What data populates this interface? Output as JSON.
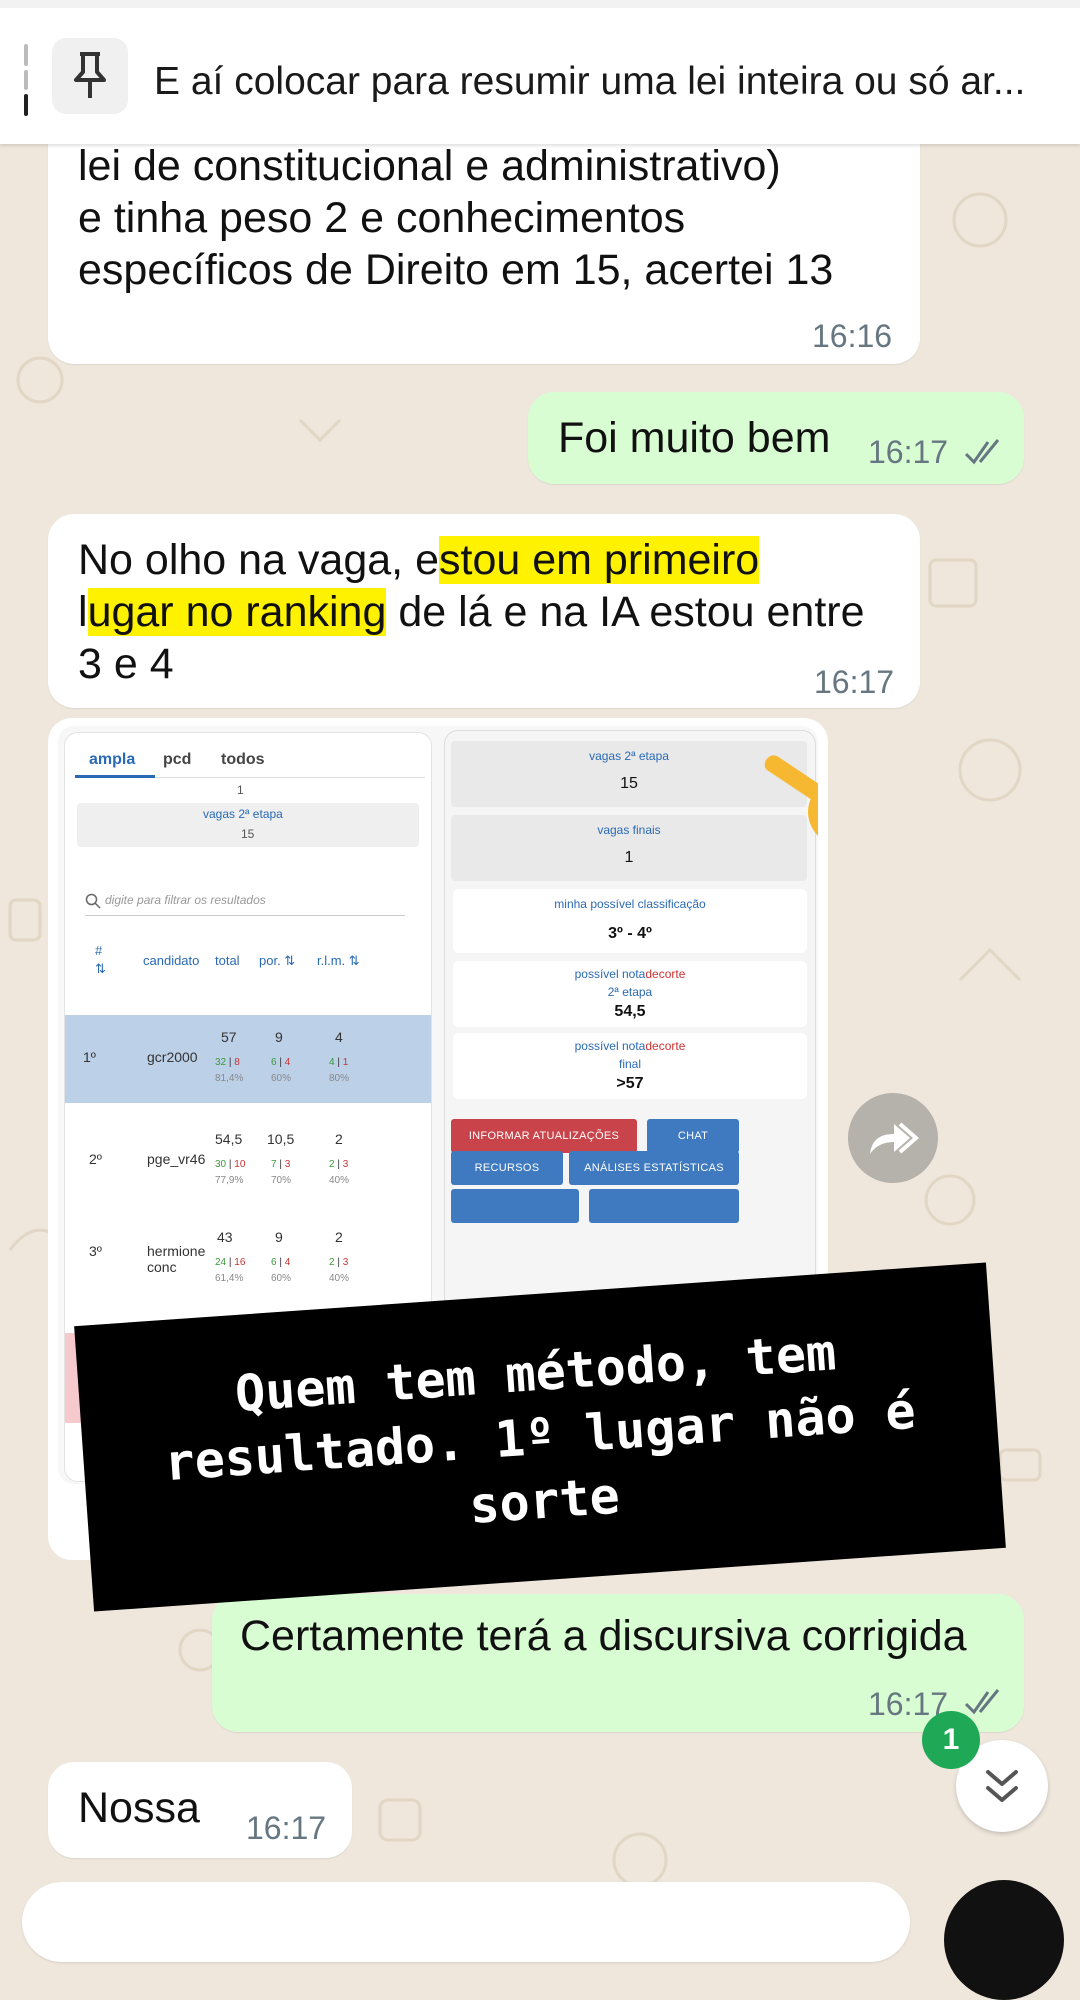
{
  "pinned": {
    "text": "E aí colocar para resumir uma lei inteira ou só ar..."
  },
  "messages": [
    {
      "lines": [
        "lei de constitucional e administrativo)",
        "e tinha peso 2 e conhecimentos",
        "específicos de Direito em 15, acertei 13"
      ],
      "time": "16:16"
    },
    {
      "text": "Foi muito bem",
      "time": "16:17"
    },
    {
      "line1_a": "No olho na vaga, e",
      "line1_hl": "stou em primeiro",
      "line2_a": "l",
      "line2_hl": "ugar no ranking",
      "line2_b": " de lá e na IA estou entre",
      "line3": "3 e 4",
      "time": "16:17"
    },
    {
      "text": "Certamente terá a discursiva corrigida",
      "time": "16:17"
    },
    {
      "text": "Nossa",
      "time": "16:17"
    }
  ],
  "shot": {
    "tabs": [
      "ampla",
      "pcd",
      "todos"
    ],
    "top_value": "1",
    "vagas_label": "vagas 2ª etapa",
    "vagas_value": "15",
    "filter_placeholder": "digite para filtrar os resultados",
    "headers": [
      "#",
      "candidato",
      "total",
      "por. ⇅",
      "r.l.m. ⇅"
    ],
    "rows": [
      {
        "rank": "1º",
        "name": "gcr2000",
        "total": "57",
        "total_g": "32",
        "total_r": "8",
        "total_p": "81,4%",
        "por": "9",
        "por_g": "6",
        "por_r": "4",
        "por_p": "60%",
        "rlm": "4",
        "rlm_g": "4",
        "rlm_r": "1",
        "rlm_p": "80%"
      },
      {
        "rank": "2º",
        "name": "pge_vr46",
        "total": "54,5",
        "total_g": "30",
        "total_r": "10",
        "total_p": "77,9%",
        "por": "10,5",
        "por_g": "7",
        "por_r": "3",
        "por_p": "70%",
        "rlm": "2",
        "rlm_g": "2",
        "rlm_r": "3",
        "rlm_p": "40%"
      },
      {
        "rank": "3º",
        "name": "hermione conc",
        "total": "43",
        "total_g": "24",
        "total_r": "16",
        "total_p": "61,4%",
        "por": "9",
        "por_g": "6",
        "por_r": "4",
        "por_p": "60%",
        "rlm": "2",
        "rlm_g": "2",
        "rlm_r": "3",
        "rlm_p": "40%"
      }
    ],
    "right": {
      "vagas2_label": "vagas 2ª etapa",
      "vagas2_value": "15",
      "vagasf_label": "vagas finais",
      "vagasf_value": "1",
      "classif_label": "minha possível classificação",
      "classif_value": "3º - 4º",
      "nota_label_a": "possível nota",
      "nota_label_b": "decorte",
      "nota2_sub": "2ª etapa",
      "nota2_value": "54,5",
      "notaf_sub": "final",
      "notaf_value": ">57",
      "btn_informar": "INFORMAR ATUALIZAÇÕES",
      "btn_chat": "CHAT",
      "btn_recursos": "RECURSOS",
      "btn_analises": "ANÁLISES ESTATÍSTICAS"
    }
  },
  "banner": {
    "text": "Quem tem método, tem resultado. 1º lugar não é sorte"
  },
  "unread_badge": "1",
  "colors": {
    "outgoing": "#d9fdd3",
    "incoming": "#ffffff",
    "highlight": "#fff200",
    "badge": "#1fa855"
  }
}
